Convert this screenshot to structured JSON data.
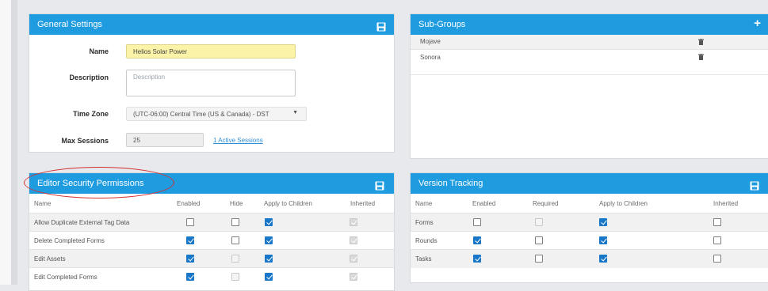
{
  "general": {
    "title": "General Settings",
    "name_label": "Name",
    "name_value": "Helios Solar Power",
    "description_label": "Description",
    "description_placeholder": "Description",
    "timezone_label": "Time Zone",
    "timezone_value": "(UTC-06:00) Central Time (US & Canada) - DST",
    "max_sessions_label": "Max Sessions",
    "max_sessions_value": "25",
    "active_sessions_link": "1 Active Sessions"
  },
  "subgroups": {
    "title": "Sub-Groups",
    "items": [
      {
        "name": "Mojave"
      },
      {
        "name": "Sonora"
      }
    ]
  },
  "editor": {
    "title": "Editor Security Permissions",
    "columns": [
      "Name",
      "Enabled",
      "Hide",
      "Apply to Children",
      "Inherited"
    ],
    "rows": [
      {
        "name": "Allow Duplicate External Tag Data",
        "enabled": false,
        "hide": false,
        "apply": true,
        "inherited": true
      },
      {
        "name": "Delete Completed Forms",
        "enabled": true,
        "hide": false,
        "apply": true,
        "inherited": true
      },
      {
        "name": "Edit Assets",
        "enabled": true,
        "hide": false,
        "apply": true,
        "inherited": true
      },
      {
        "name": "Edit Completed Forms",
        "enabled": true,
        "hide": false,
        "apply": true,
        "inherited": true
      }
    ]
  },
  "version": {
    "title": "Version Tracking",
    "columns": [
      "Name",
      "Enabled",
      "Required",
      "Apply to Children",
      "Inherited"
    ],
    "rows": [
      {
        "name": "Forms",
        "enabled": false,
        "required": false,
        "apply": true,
        "inherited": false
      },
      {
        "name": "Rounds",
        "enabled": true,
        "required": false,
        "apply": true,
        "inherited": false
      },
      {
        "name": "Tasks",
        "enabled": true,
        "required": false,
        "apply": true,
        "inherited": false
      }
    ]
  },
  "colors": {
    "header": "#1f9ce0",
    "highlight_circle": "#d52f2f",
    "checkbox_on": "#1877c9",
    "name_field_bg": "#fbf3a7"
  },
  "icons": {
    "save": "save-icon",
    "add": "plus-icon",
    "delete": "trash-icon",
    "dropdown": "caret-down-icon"
  }
}
